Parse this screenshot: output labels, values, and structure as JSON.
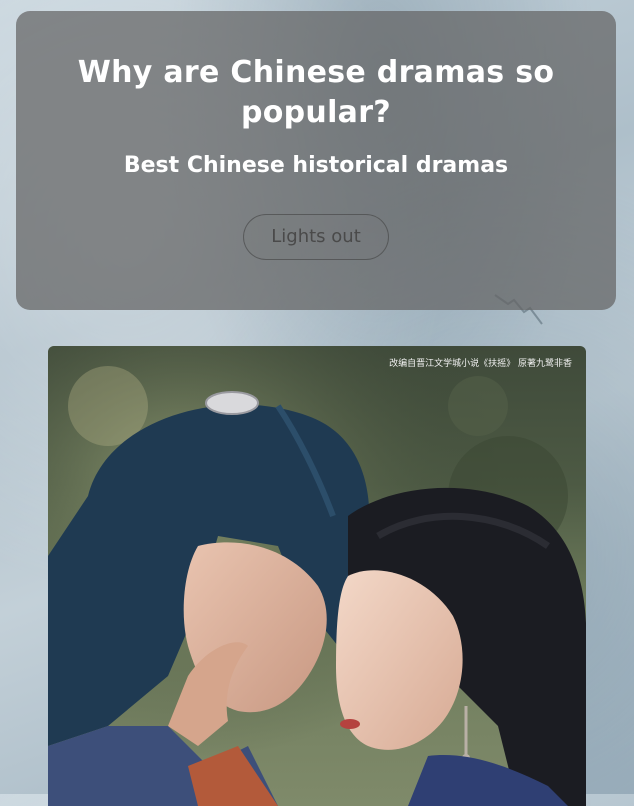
{
  "header": {
    "title": "Why are Chinese dramas so popular?",
    "subtitle": "Best Chinese historical dramas",
    "lights_button_label": "Lights out"
  },
  "poster": {
    "caption": "改编自晋江文学城小说《扶摇》 原著九鹭非香"
  },
  "colors": {
    "card_background": "#646464",
    "text": "#ffffff",
    "button_text": "#4a4a4a"
  }
}
